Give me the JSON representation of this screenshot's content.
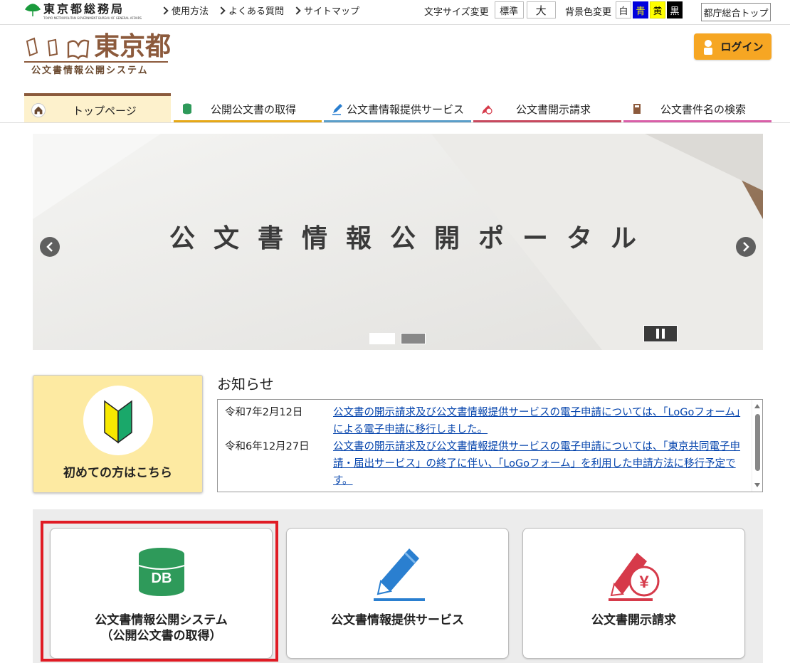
{
  "bureau": {
    "name": "東京都総務局",
    "sub": "TOKYO METROPOLITAN GOVERNMENT BUREAU OF GENERAL AFFAIRS"
  },
  "util_links": [
    "使用方法",
    "よくある質問",
    "サイトマップ"
  ],
  "font_size": {
    "label": "文字サイズ変更",
    "options": [
      "標準",
      "大"
    ]
  },
  "bg_color": {
    "label": "背景色変更",
    "options": [
      "白",
      "青",
      "黄",
      "黒"
    ]
  },
  "tokyo_top": "都庁総合トップ",
  "logo": {
    "title": "東京都",
    "subtitle": "公文書情報公開システム"
  },
  "login": {
    "label": "ログイン"
  },
  "nav": [
    {
      "label": "トップページ",
      "color": "#8b5a3c"
    },
    {
      "label": "公開公文書の取得",
      "color": "#e6a817"
    },
    {
      "label": "公文書情報提供サービス",
      "color": "#5b9ec9"
    },
    {
      "label": "公文書開示請求",
      "color": "#c8495f"
    },
    {
      "label": "公文書件名の検索",
      "color": "#d95fa8"
    }
  ],
  "slider": {
    "title": "公文書情報公開ポータル"
  },
  "beginner": {
    "label": "初めての方はこちら"
  },
  "news": {
    "heading": "お知らせ",
    "items": [
      {
        "date": "令和7年2月12日",
        "text": "公文書の開示請求及び公文書情報提供サービスの電子申請については、「LoGoフォーム」による電子申請に移行しました。"
      },
      {
        "date": "令和6年12月27日",
        "text": "公文書の開示請求及び公文書情報提供サービスの電子申請については、「東京共同電子申請・届出サービス」の終了に伴い、「LoGoフォーム」を利用した申請方法に移行予定です。"
      }
    ]
  },
  "cards": [
    {
      "line1": "公文書情報公開システム",
      "line2": "（公開公文書の取得）"
    },
    {
      "line1": "公文書情報提供サービス",
      "line2": ""
    },
    {
      "line1": "公文書開示請求",
      "line2": ""
    }
  ],
  "colors": {
    "accent_login": "#f6a623",
    "brand_brown": "#8c5a3c",
    "highlight_red": "#e01b24",
    "db_green": "#2e9a5a",
    "pen_blue": "#2a7fd0",
    "yen_red": "#d63a4a"
  }
}
